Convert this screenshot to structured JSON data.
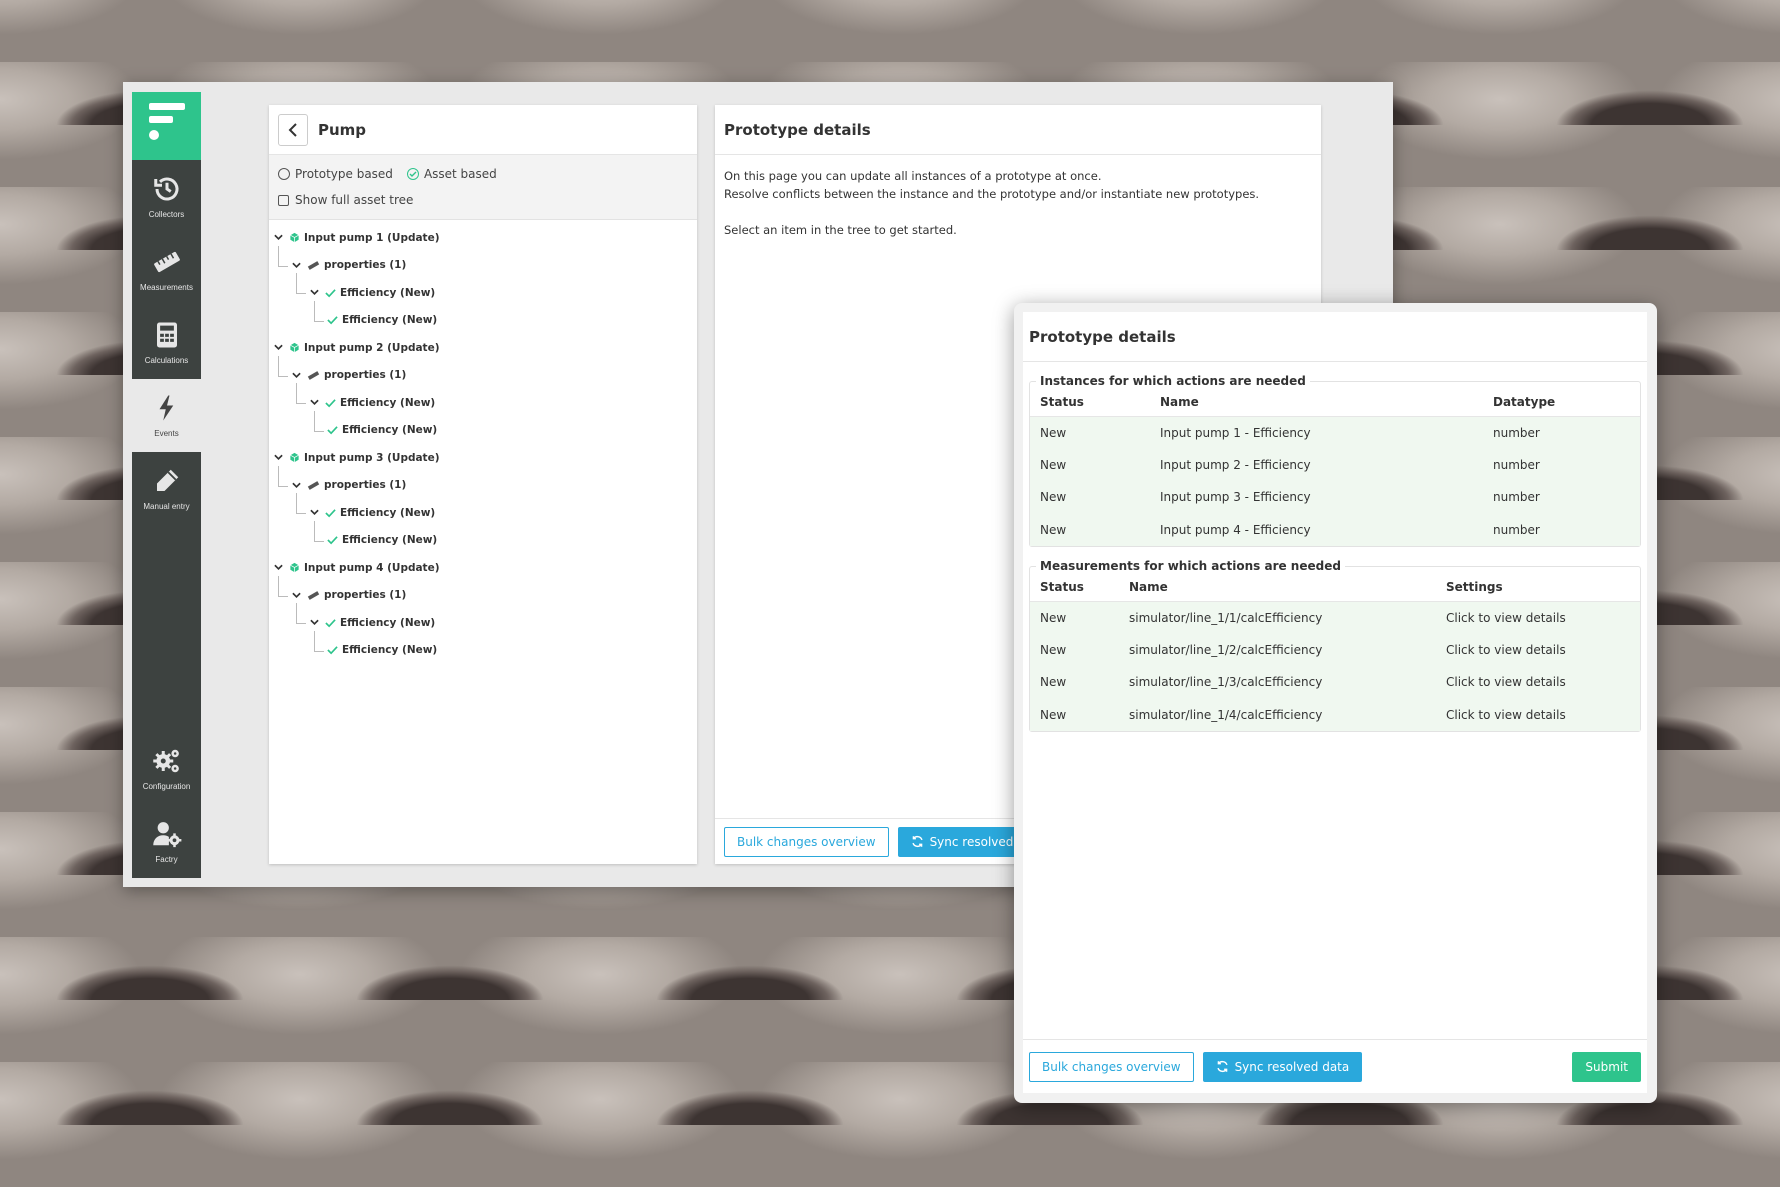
{
  "sidebar": {
    "items": [
      {
        "label": "Collectors",
        "icon": "history-icon"
      },
      {
        "label": "Measurements",
        "icon": "ruler-icon"
      },
      {
        "label": "Calculations",
        "icon": "calculator-icon"
      },
      {
        "label": "Events",
        "icon": "bolt-icon"
      },
      {
        "label": "Manual entry",
        "icon": "pencil-icon"
      }
    ],
    "bottom": [
      {
        "label": "Configuration",
        "icon": "gears-icon"
      },
      {
        "label": "Factry",
        "icon": "user-gear-icon"
      }
    ]
  },
  "tree_panel": {
    "title": "Pump",
    "option_prototype": "Prototype based",
    "option_asset": "Asset based",
    "show_full_tree": "Show full asset tree",
    "nodes": [
      {
        "label": "Input pump 1 (Update)",
        "properties": "properties (1)",
        "children": [
          "Efficiency (New)",
          "Efficiency (New)"
        ]
      },
      {
        "label": "Input pump 2 (Update)",
        "properties": "properties (1)",
        "children": [
          "Efficiency (New)",
          "Efficiency (New)"
        ]
      },
      {
        "label": "Input pump 3 (Update)",
        "properties": "properties (1)",
        "children": [
          "Efficiency (New)",
          "Efficiency (New)"
        ]
      },
      {
        "label": "Input pump 4 (Update)",
        "properties": "properties (1)",
        "children": [
          "Efficiency (New)",
          "Efficiency (New)"
        ]
      }
    ]
  },
  "details_panel": {
    "title": "Prototype details",
    "line1": "On this page you can update all instances of a prototype at once.",
    "line2": "Resolve conflicts between the instance and the prototype and/or instantiate new prototypes.",
    "line3": "Select an item in the tree to get started.",
    "bulk_label": "Bulk changes overview",
    "sync_label": "Sync resolved data"
  },
  "overlay": {
    "title": "Prototype details",
    "instances": {
      "legend": "Instances for which actions are needed",
      "headers": [
        "Status",
        "Name",
        "Datatype"
      ],
      "rows": [
        [
          "New",
          "Input pump 1 - Efficiency",
          "number"
        ],
        [
          "New",
          "Input pump 2 - Efficiency",
          "number"
        ],
        [
          "New",
          "Input pump 3 - Efficiency",
          "number"
        ],
        [
          "New",
          "Input pump 4 - Efficiency",
          "number"
        ]
      ]
    },
    "measurements": {
      "legend": "Measurements for which actions are needed",
      "headers": [
        "Status",
        "Name",
        "Settings"
      ],
      "rows": [
        [
          "New",
          "simulator/line_1/1/calcEfficiency",
          "Click to view details"
        ],
        [
          "New",
          "simulator/line_1/2/calcEfficiency",
          "Click to view details"
        ],
        [
          "New",
          "simulator/line_1/3/calcEfficiency",
          "Click to view details"
        ],
        [
          "New",
          "simulator/line_1/4/calcEfficiency",
          "Click to view details"
        ]
      ]
    },
    "bulk_label": "Bulk changes overview",
    "sync_label": "Sync resolved data",
    "submit_label": "Submit"
  },
  "colors": {
    "brand": "#2ec48c",
    "primary": "#2aa8dc",
    "sidebar": "#3d4240",
    "row_highlight": "#f0f8f0"
  }
}
